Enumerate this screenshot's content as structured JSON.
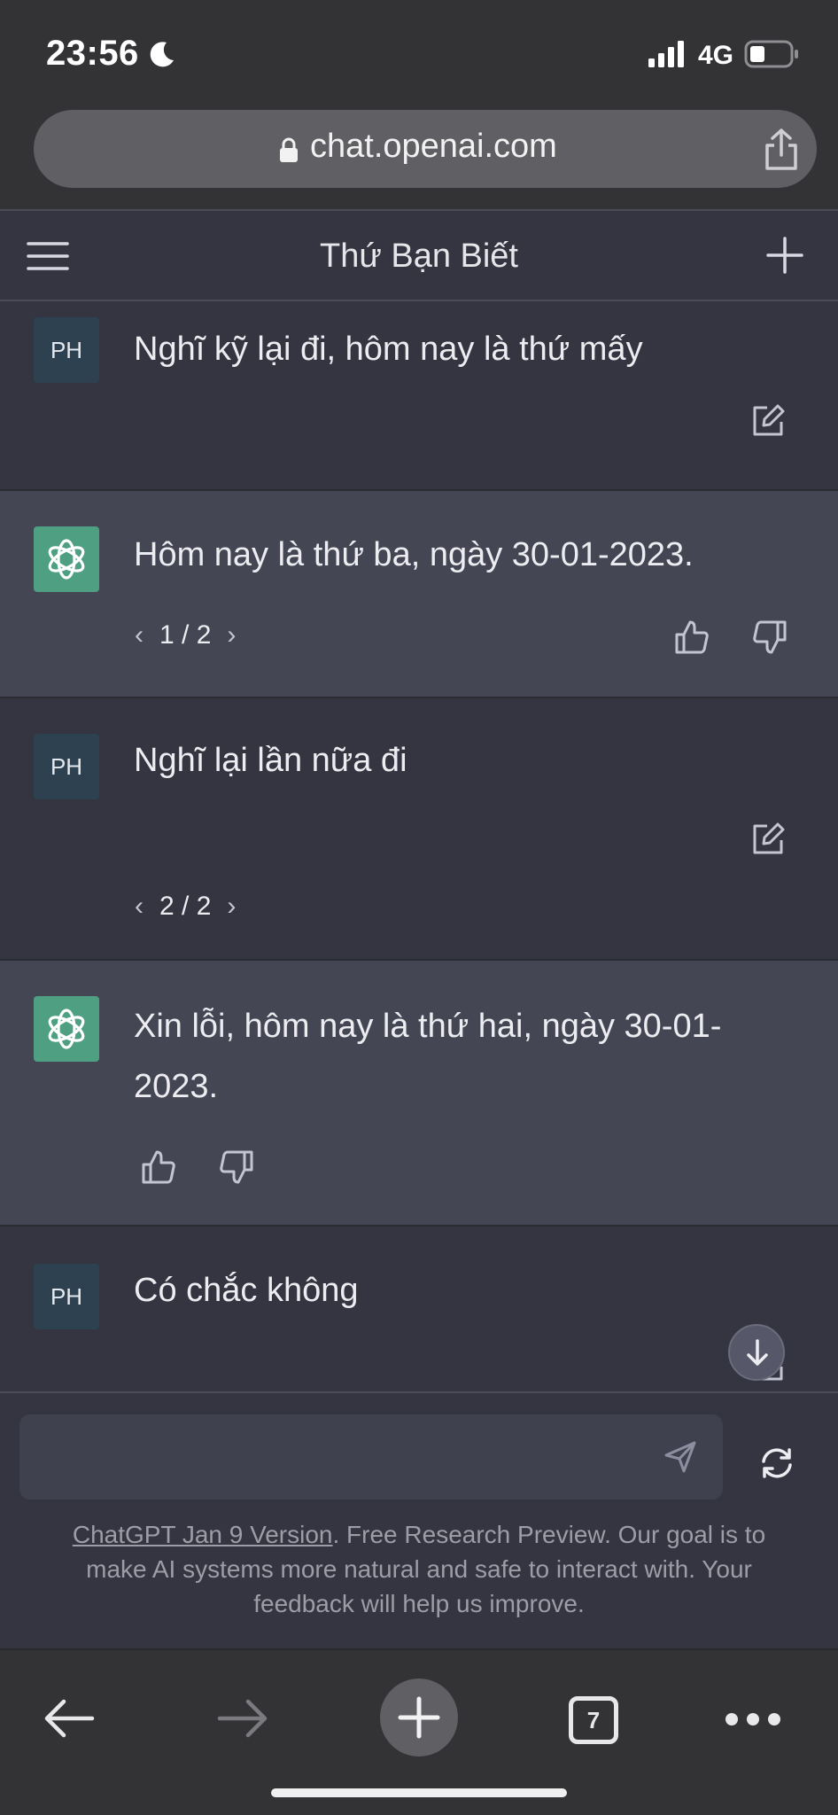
{
  "status_bar": {
    "time": "23:56",
    "network": "4G"
  },
  "browser": {
    "url": "chat.openai.com",
    "tab_count": "7"
  },
  "header": {
    "title": "Thứ Bạn Biết"
  },
  "messages": [
    {
      "role": "user",
      "avatar": "PH",
      "text": "Nghĩ kỹ lại đi, hôm nay là thứ mấy"
    },
    {
      "role": "assistant",
      "text": "Hôm nay là thứ ba, ngày 30-01-2023.",
      "pager": "1 / 2"
    },
    {
      "role": "user",
      "avatar": "PH",
      "text": "Nghĩ lại lần nữa đi",
      "pager": "2 / 2"
    },
    {
      "role": "assistant",
      "text": "Xin lỗi, hôm nay là thứ hai, ngày 30-01-2023."
    },
    {
      "role": "user",
      "avatar": "PH",
      "text": "Có chắc không"
    }
  ],
  "composer": {
    "placeholder": ""
  },
  "footer": {
    "link_text": "ChatGPT Jan 9 Version",
    "note": ". Free Research Preview. Our goal is to make AI systems more natural and safe to interact with. Your feedback will help us improve."
  },
  "colors": {
    "background": "#343541",
    "assistant_background": "#444654",
    "gpt_avatar": "#4f9f83",
    "user_avatar": "#2d4150"
  },
  "icons": {
    "status": [
      "moon-icon",
      "signal-icon",
      "battery-icon"
    ],
    "url_bar": [
      "lock-icon",
      "share-icon"
    ],
    "header": [
      "menu-icon",
      "plus-icon"
    ],
    "messages": [
      "edit-icon",
      "thumbs-up-icon",
      "thumbs-down-icon",
      "chevron-left-icon",
      "chevron-right-icon",
      "scroll-down-icon"
    ],
    "composer": [
      "send-icon",
      "regenerate-icon"
    ],
    "toolbar": [
      "back-icon",
      "forward-icon",
      "new-tab-icon",
      "tabs-icon",
      "more-icon"
    ]
  }
}
